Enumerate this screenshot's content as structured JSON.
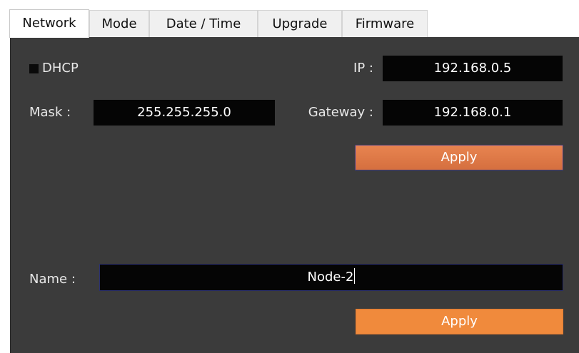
{
  "tabs": [
    {
      "label": "Network",
      "active": true
    },
    {
      "label": "Mode",
      "active": false
    },
    {
      "label": "Date / Time",
      "active": false
    },
    {
      "label": "Upgrade",
      "active": false
    },
    {
      "label": "Firmware",
      "active": false
    }
  ],
  "network": {
    "dhcp_label": "DHCP",
    "dhcp_checked": false,
    "ip_label": "IP :",
    "ip_value": "192.168.0.5",
    "mask_label": "Mask :",
    "mask_value": "255.255.255.0",
    "gateway_label": "Gateway :",
    "gateway_value": "192.168.0.1",
    "apply_label": "Apply"
  },
  "name_section": {
    "name_label": "Name :",
    "name_value": "Node-2",
    "apply_label": "Apply"
  },
  "colors": {
    "panel_bg": "#3b3b3b",
    "field_bg": "#050505",
    "apply_primary": "#e0794a",
    "apply_secondary": "#f08a3c"
  }
}
